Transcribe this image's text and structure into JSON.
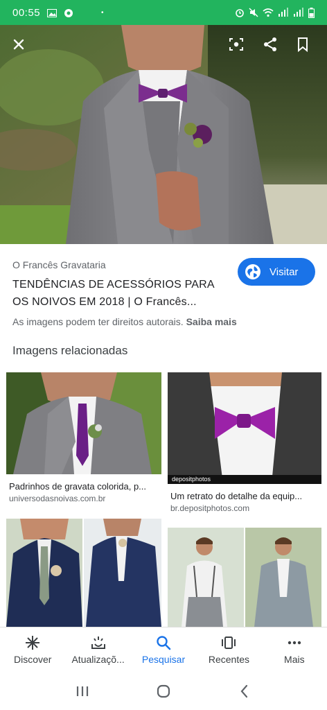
{
  "status_bar": {
    "time": "00:55"
  },
  "result": {
    "source": "O Francês Gravataria",
    "title": "TENDÊNCIAS DE ACESSÓRIOS PARA OS NOIVOS EM 2018 | O Francês...",
    "visit_label": "Visitar",
    "rights_text": "As imagens podem ter direitos autorais.",
    "learn_more": "Saiba mais"
  },
  "related": {
    "heading": "Imagens relacionadas",
    "items": [
      {
        "caption": "Padrinhos de gravata colorida, p...",
        "domain": "universodasnoivas.com.br"
      },
      {
        "caption": "Um retrato do detalhe da equip...",
        "domain": "br.depositphotos.com",
        "watermark": "depositphotos"
      },
      {
        "caption": "",
        "domain": ""
      },
      {
        "caption": "",
        "domain": ""
      }
    ]
  },
  "bottom_nav": [
    {
      "label": "Discover",
      "icon": "asterisk-icon"
    },
    {
      "label": "Atualizaçõ...",
      "icon": "updates-icon"
    },
    {
      "label": "Pesquisar",
      "icon": "search-icon",
      "active": true
    },
    {
      "label": "Recentes",
      "icon": "recents-icon"
    },
    {
      "label": "Mais",
      "icon": "more-dots-icon"
    }
  ],
  "colors": {
    "accent": "#1a73e8",
    "status_bar": "#22b45e",
    "tie_purple": "#7b2d8e"
  }
}
